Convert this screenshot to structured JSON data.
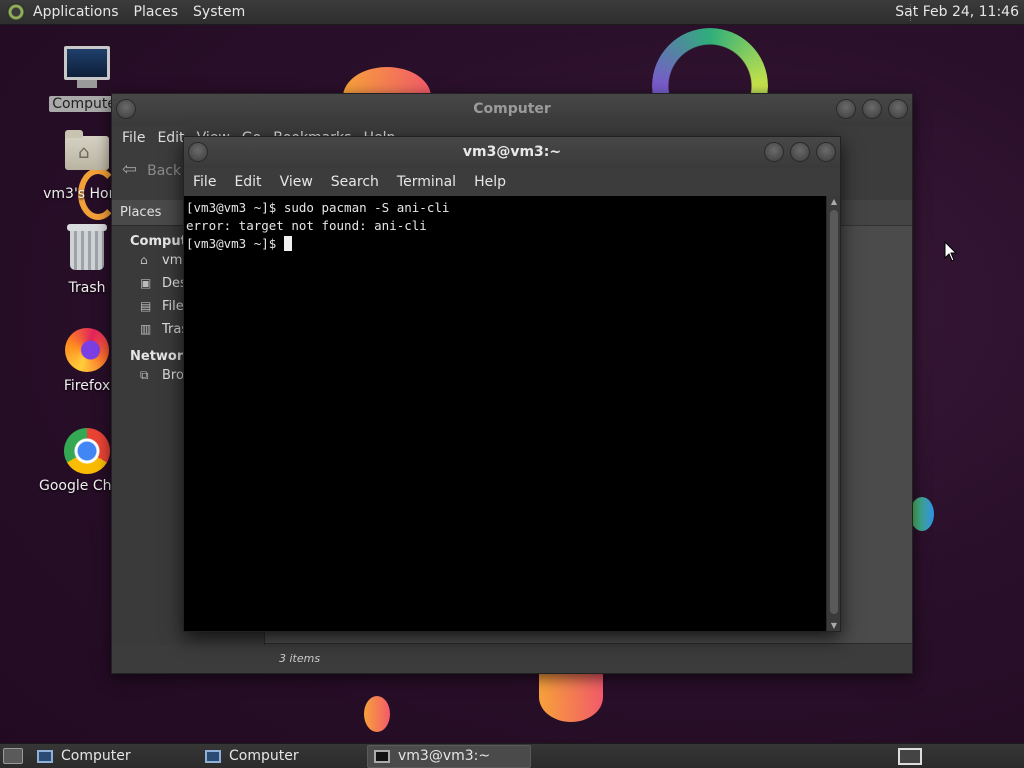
{
  "top_panel": {
    "menus": [
      "Applications",
      "Places",
      "System"
    ],
    "clock": "Sat Feb 24, 11:46"
  },
  "desktop_icons": [
    {
      "label": "Computer",
      "icon": "computer-icon",
      "selected": true
    },
    {
      "label": "vm3's Home",
      "icon": "home-folder-icon",
      "selected": false
    },
    {
      "label": "Trash",
      "icon": "trash-icon",
      "selected": false
    },
    {
      "label": "Firefox",
      "icon": "firefox-icon",
      "selected": false
    },
    {
      "label": "Google Chrome",
      "icon": "chrome-icon",
      "selected": false
    }
  ],
  "computer_window": {
    "title": "Computer",
    "menu": [
      "File",
      "Edit",
      "View",
      "Go",
      "Bookmarks",
      "Help"
    ],
    "back_label": "Back",
    "places_header": "Places",
    "sections": [
      {
        "title": "Computer",
        "items": [
          {
            "label": "vm3",
            "icon": "home-icon"
          },
          {
            "label": "Desktop",
            "icon": "desktop-icon"
          },
          {
            "label": "File System",
            "icon": "drive-icon"
          },
          {
            "label": "Trash",
            "icon": "trash-icon"
          }
        ]
      },
      {
        "title": "Network",
        "items": [
          {
            "label": "Browse Network",
            "icon": "network-icon"
          }
        ]
      }
    ],
    "status": "3 items"
  },
  "terminal_window": {
    "title": "vm3@vm3:~",
    "menu": [
      "File",
      "Edit",
      "View",
      "Search",
      "Terminal",
      "Help"
    ],
    "lines": [
      "[vm3@vm3 ~]$ sudo pacman -S ani-cli",
      "error: target not found: ani-cli",
      "[vm3@vm3 ~]$ "
    ]
  },
  "taskbar": {
    "tasks": [
      {
        "label": "Computer",
        "icon": "file-manager-icon",
        "active": false
      },
      {
        "label": "Computer",
        "icon": "file-manager-icon",
        "active": false
      },
      {
        "label": "vm3@vm3:~",
        "icon": "terminal-icon",
        "active": true
      }
    ]
  },
  "colors": {
    "wallpaper": "#2a0f2a",
    "panel": "#333333",
    "window_bg": "#3c3c3c",
    "terminal_bg": "#000000",
    "terminal_fg": "#e6e6e6"
  }
}
